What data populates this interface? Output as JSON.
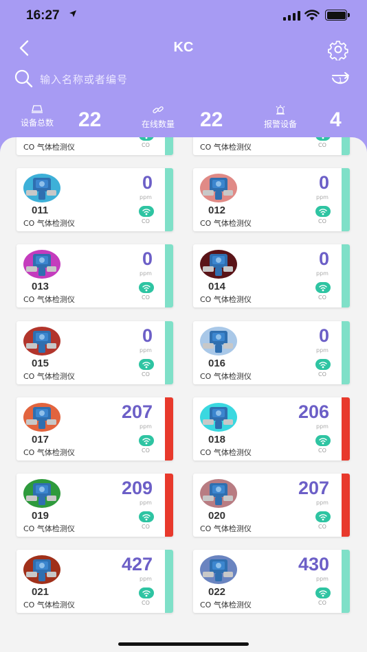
{
  "status_bar": {
    "time": "16:27"
  },
  "nav": {
    "title": "KC"
  },
  "search": {
    "placeholder": "输入名称或者编号",
    "badge": "1"
  },
  "stats": [
    {
      "label": "设备总数",
      "value": "22",
      "icon": "device-icon"
    },
    {
      "label": "在线数量",
      "value": "22",
      "icon": "link-icon"
    },
    {
      "label": "报警设备",
      "value": "4",
      "icon": "alarm-icon"
    }
  ],
  "colors": {
    "accent": "#a79bf3",
    "normal": "#7fe0c8",
    "alarm": "#e8392c",
    "value": "#6c5fc7",
    "badge": "#2ec4a2"
  },
  "devices": [
    {
      "no": "",
      "name": "CO 气体检测仪",
      "value": "",
      "unit": "",
      "gas": "CO",
      "status": "normal",
      "bg": "#5bb9e0"
    },
    {
      "no": "",
      "name": "CO 气体检测仪",
      "value": "",
      "unit": "",
      "gas": "CO",
      "status": "normal",
      "bg": "#5bb9e0"
    },
    {
      "no": "011",
      "name": "CO 气体检测仪",
      "value": "0",
      "unit": "ppm",
      "gas": "CO",
      "status": "normal",
      "bg": "#3db0d8"
    },
    {
      "no": "012",
      "name": "CO 气体检测仪",
      "value": "0",
      "unit": "ppm",
      "gas": "CO",
      "status": "normal",
      "bg": "#e08a86"
    },
    {
      "no": "013",
      "name": "CO 气体检测仪",
      "value": "0",
      "unit": "ppm",
      "gas": "CO",
      "status": "normal",
      "bg": "#c43cbd"
    },
    {
      "no": "014",
      "name": "CO 气体检测仪",
      "value": "0",
      "unit": "ppm",
      "gas": "CO",
      "status": "normal",
      "bg": "#5a1418"
    },
    {
      "no": "015",
      "name": "CO 气体检测仪",
      "value": "0",
      "unit": "ppm",
      "gas": "CO",
      "status": "normal",
      "bg": "#b2352c"
    },
    {
      "no": "016",
      "name": "CO 气体检测仪",
      "value": "0",
      "unit": "ppm",
      "gas": "CO",
      "status": "normal",
      "bg": "#a9c8e8"
    },
    {
      "no": "017",
      "name": "CO 气体检测仪",
      "value": "207",
      "unit": "ppm",
      "gas": "CO",
      "status": "alarm",
      "bg": "#e2643e"
    },
    {
      "no": "018",
      "name": "CO 气体检测仪",
      "value": "206",
      "unit": "ppm",
      "gas": "CO",
      "status": "alarm",
      "bg": "#3ad8e0"
    },
    {
      "no": "019",
      "name": "CO 气体检测仪",
      "value": "209",
      "unit": "ppm",
      "gas": "CO",
      "status": "alarm",
      "bg": "#2e9a3c"
    },
    {
      "no": "020",
      "name": "CO 气体检测仪",
      "value": "207",
      "unit": "ppm",
      "gas": "CO",
      "status": "alarm",
      "bg": "#b87c82"
    },
    {
      "no": "021",
      "name": "CO 气体检测仪",
      "value": "427",
      "unit": "ppm",
      "gas": "CO",
      "status": "normal",
      "bg": "#a0301a"
    },
    {
      "no": "022",
      "name": "CO 气体检测仪",
      "value": "430",
      "unit": "ppm",
      "gas": "CO",
      "status": "normal",
      "bg": "#6a84c0"
    }
  ]
}
